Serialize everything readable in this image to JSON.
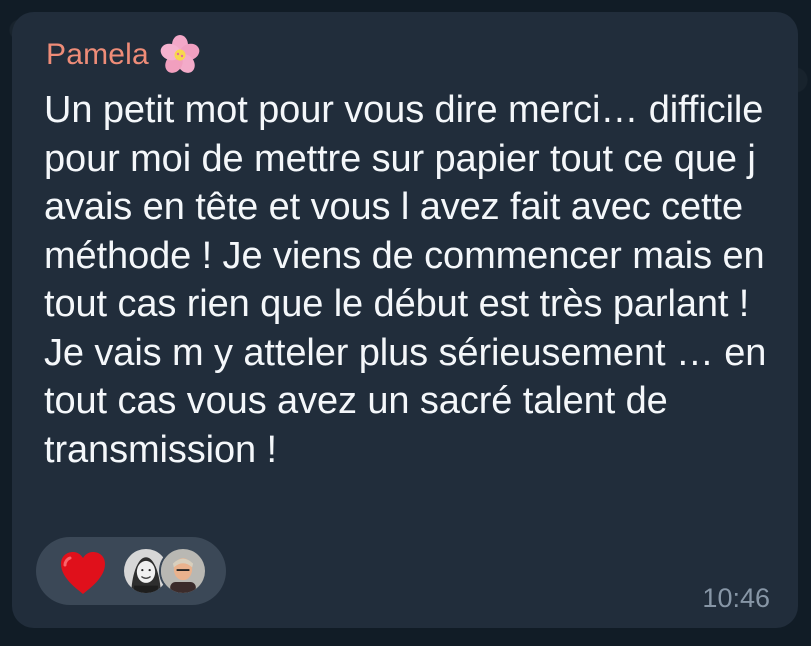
{
  "message": {
    "sender": "Pamela",
    "sender_emoji": "flower-icon",
    "text": "Un petit mot pour vous dire merci… difficile pour moi de mettre sur papier tout ce que j avais en tête et vous l avez fait avec cette méthode ! Je viens de commencer mais en tout cas rien que le début est très parlant ! Je vais m y atteler plus sérieusement … en tout cas vous avez un sacré talent de transmission !",
    "time": "10:46"
  },
  "reactions": {
    "emoji": "heart-icon",
    "users": [
      {
        "avatar": "avatar-woman"
      },
      {
        "avatar": "avatar-man"
      }
    ]
  },
  "colors": {
    "background": "#111c26",
    "bubble": "#212d3b",
    "sender_name": "#ee8c78",
    "message_text": "#f4f7fa",
    "time": "#8796a6",
    "reaction_pill": "#3b4857",
    "heart": "#e0101b"
  }
}
